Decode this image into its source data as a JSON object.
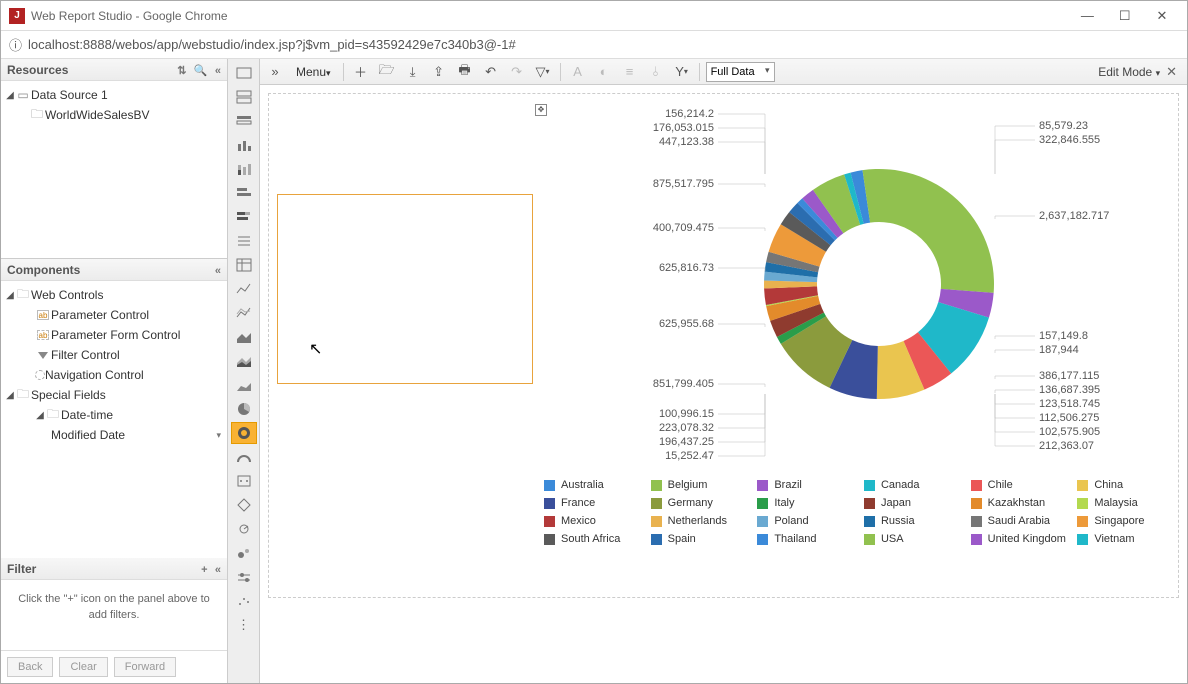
{
  "window": {
    "title": "Web Report Studio - Google Chrome"
  },
  "addressbar": {
    "url": "localhost:8888/webos/app/webstudio/index.jsp?j$vm_pid=s43592429e7c340b3@-1#"
  },
  "left": {
    "resources": {
      "title": "Resources",
      "datasource": "Data Source 1",
      "item1": "WorldWideSalesBV"
    },
    "components": {
      "title": "Components",
      "webcontrols": "Web Controls",
      "param": "Parameter Control",
      "paramform": "Parameter Form Control",
      "filter": "Filter Control",
      "nav": "Navigation Control",
      "special": "Special Fields",
      "datetime": "Date-time",
      "modified": "Modified Date"
    },
    "filter": {
      "title": "Filter",
      "hint": "Click the \"+\" icon on the panel above to add filters."
    }
  },
  "buttons": {
    "back": "Back",
    "clear": "Clear",
    "forward": "Forward"
  },
  "toolbar": {
    "menu": "Menu",
    "fulldata": "Full Data",
    "editmode": "Edit Mode"
  },
  "chart_data": {
    "type": "donut",
    "series": [
      {
        "label": "Australia",
        "value": 156214.2,
        "color": "#3b8ad9"
      },
      {
        "label": "Belgium",
        "value": 2637182.717,
        "color": "#91c14f"
      },
      {
        "label": "Brazil",
        "value": 322846.555,
        "color": "#9b59c9"
      },
      {
        "label": "Canada",
        "value": 875517.795,
        "color": "#1fb8c9"
      },
      {
        "label": "Chile",
        "value": 400709.475,
        "color": "#eb5757"
      },
      {
        "label": "China",
        "value": 625816.73,
        "color": "#eac54f"
      },
      {
        "label": "France",
        "value": 625955.68,
        "color": "#3a4f9b"
      },
      {
        "label": "Germany",
        "value": 851799.405,
        "color": "#8b9b3d"
      },
      {
        "label": "Italy",
        "value": 100996.15,
        "color": "#2a9d4a"
      },
      {
        "label": "Japan",
        "value": 223078.32,
        "color": "#8f3b2f"
      },
      {
        "label": "Kazakhstan",
        "value": 196437.25,
        "color": "#e38b2b"
      },
      {
        "label": "Malaysia",
        "value": 15252.47,
        "color": "#b3d94f"
      },
      {
        "label": "Mexico",
        "value": 212363.07,
        "color": "#b33939"
      },
      {
        "label": "Netherlands",
        "value": 102575.905,
        "color": "#e9b24f"
      },
      {
        "label": "Poland",
        "value": 112506.275,
        "color": "#6aa9d1"
      },
      {
        "label": "Russia",
        "value": 123518.745,
        "color": "#1f6fa8"
      },
      {
        "label": "Saudi Arabia",
        "value": 136687.395,
        "color": "#767676"
      },
      {
        "label": "Singapore",
        "value": 386177.115,
        "color": "#ed9a3a"
      },
      {
        "label": "South Africa",
        "value": 187944,
        "color": "#5a5a5a"
      },
      {
        "label": "Spain",
        "value": 157149.8,
        "color": "#2b6db0"
      },
      {
        "label": "Thailand",
        "value": 85579.23,
        "color": "#3b8ad9"
      },
      {
        "label": "United Kingdom",
        "value": 176053.015,
        "color": "#9b59c9"
      },
      {
        "label": "USA",
        "value": 447123.38,
        "color": "#91c14f"
      },
      {
        "label": "Vietnam",
        "value": 85000,
        "color": "#1fb8c9"
      }
    ],
    "left_labels": [
      "156,214.2",
      "176,053.015",
      "447,123.38",
      "875,517.795",
      "400,709.475",
      "625,816.73",
      "625,955.68",
      "851,799.405",
      "100,996.15",
      "223,078.32",
      "196,437.25",
      "15,252.47"
    ],
    "right_labels": [
      "85,579.23",
      "322,846.555",
      "2,637,182.717",
      "157,149.8",
      "187,944",
      "386,177.115",
      "136,687.395",
      "123,518.745",
      "112,506.275",
      "102,575.905",
      "212,363.07"
    ]
  },
  "legend_order": [
    "Australia",
    "Belgium",
    "Brazil",
    "Canada",
    "Chile",
    "China",
    "France",
    "Germany",
    "Italy",
    "Japan",
    "Kazakhstan",
    "Malaysia",
    "Mexico",
    "Netherlands",
    "Poland",
    "Russia",
    "Saudi Arabia",
    "Singapore",
    "South Africa",
    "Spain",
    "Thailand",
    "USA",
    "United Kingdom",
    "Vietnam"
  ]
}
